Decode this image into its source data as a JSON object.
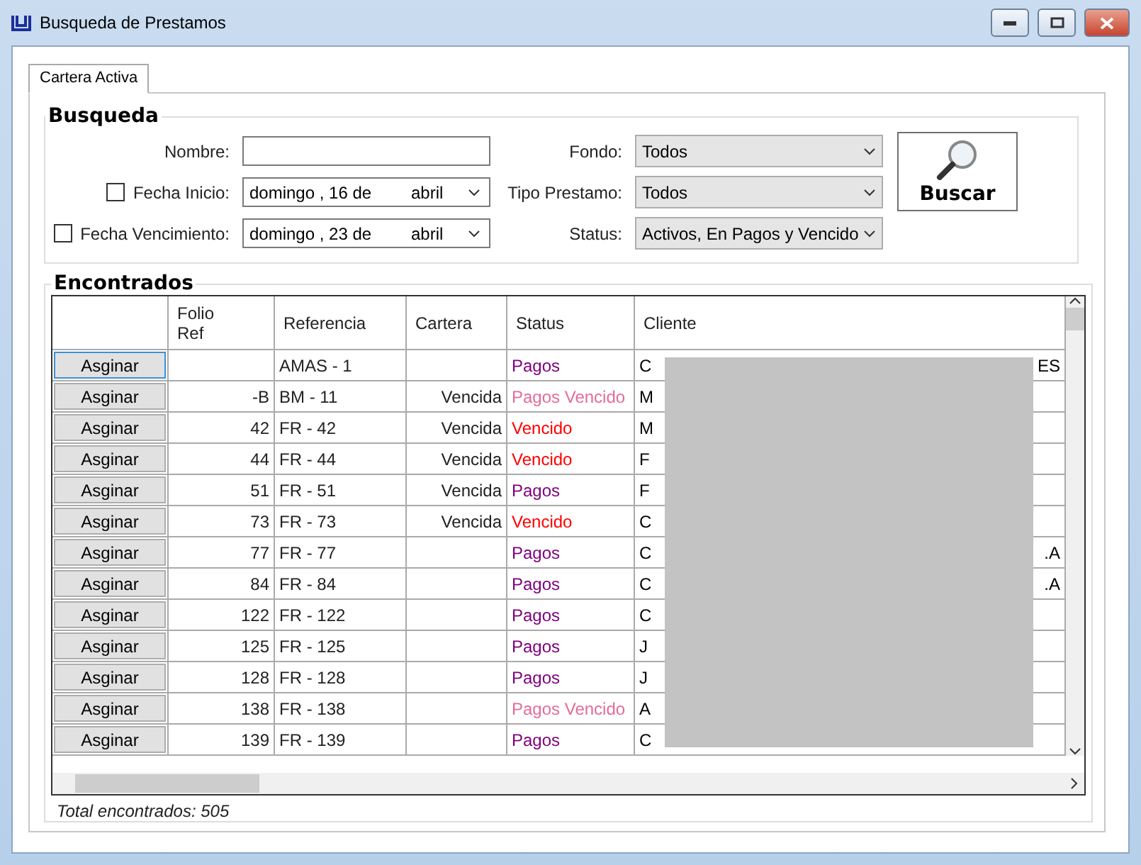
{
  "window": {
    "title": "Busqueda de Prestamos"
  },
  "tabs": [
    {
      "label": "Cartera Activa",
      "selected": true
    }
  ],
  "search": {
    "title": "Busqueda",
    "nombre": {
      "label": "Nombre:"
    },
    "fecha_inicio": {
      "label": "Fecha Inicio:",
      "checked": false,
      "weekday": "domingo , 16 de",
      "month": "abril"
    },
    "fecha_vencimiento": {
      "label": "Fecha Vencimiento:",
      "checked": false,
      "weekday": "domingo , 23 de",
      "month": "abril"
    },
    "fondo": {
      "label": "Fondo:",
      "value": "Todos"
    },
    "tipo": {
      "label": "Tipo Prestamo:",
      "value": "Todos"
    },
    "status": {
      "label": "Status:",
      "value": "Activos, En Pagos y Vencido"
    },
    "button": "Buscar"
  },
  "results": {
    "title": "Encontrados",
    "columns": [
      "Folio\nRef",
      "Referencia",
      "Cartera",
      "Status",
      "Cliente"
    ],
    "rows": [
      {
        "button": "Asginar",
        "focused": true,
        "folio": "",
        "ref": "AMAS - 1",
        "cartera": "",
        "status": "Pagos",
        "color": "#800080",
        "cliente": "C",
        "cliente_end": "ES"
      },
      {
        "button": "Asginar",
        "focused": false,
        "folio": "-B",
        "ref": "BM - 11",
        "cartera": "Vencida",
        "status": "Pagos Vencido",
        "color": "#e36c9a",
        "cliente": "M",
        "cliente_end": ""
      },
      {
        "button": "Asginar",
        "focused": false,
        "folio": "42",
        "ref": "FR - 42",
        "cartera": "Vencida",
        "status": "Vencido",
        "color": "#ff0000",
        "cliente": "M",
        "cliente_end": ""
      },
      {
        "button": "Asginar",
        "focused": false,
        "folio": "44",
        "ref": "FR - 44",
        "cartera": "Vencida",
        "status": "Vencido",
        "color": "#ff0000",
        "cliente": "F",
        "cliente_end": ""
      },
      {
        "button": "Asginar",
        "focused": false,
        "folio": "51",
        "ref": "FR - 51",
        "cartera": "Vencida",
        "status": "Pagos",
        "color": "#800080",
        "cliente": "F",
        "cliente_end": ""
      },
      {
        "button": "Asginar",
        "focused": false,
        "folio": "73",
        "ref": "FR - 73",
        "cartera": "Vencida",
        "status": "Vencido",
        "color": "#ff0000",
        "cliente": "C",
        "cliente_end": ""
      },
      {
        "button": "Asginar",
        "focused": false,
        "folio": "77",
        "ref": "FR - 77",
        "cartera": "",
        "status": "Pagos",
        "color": "#800080",
        "cliente": "C",
        "cliente_end": ".A"
      },
      {
        "button": "Asginar",
        "focused": false,
        "folio": "84",
        "ref": "FR - 84",
        "cartera": "",
        "status": "Pagos",
        "color": "#800080",
        "cliente": "C",
        "cliente_end": ".A"
      },
      {
        "button": "Asginar",
        "focused": false,
        "folio": "122",
        "ref": "FR - 122",
        "cartera": "",
        "status": "Pagos",
        "color": "#800080",
        "cliente": "C",
        "cliente_end": ""
      },
      {
        "button": "Asginar",
        "focused": false,
        "folio": "125",
        "ref": "FR - 125",
        "cartera": "",
        "status": "Pagos",
        "color": "#800080",
        "cliente": "J",
        "cliente_end": ""
      },
      {
        "button": "Asginar",
        "focused": false,
        "folio": "128",
        "ref": "FR - 128",
        "cartera": "",
        "status": "Pagos",
        "color": "#800080",
        "cliente": "J",
        "cliente_end": ""
      },
      {
        "button": "Asginar",
        "focused": false,
        "folio": "138",
        "ref": "FR - 138",
        "cartera": "",
        "status": "Pagos Vencido",
        "color": "#e36c9a",
        "cliente": "A",
        "cliente_end": ""
      },
      {
        "button": "Asginar",
        "focused": false,
        "folio": "139",
        "ref": "FR - 139",
        "cartera": "",
        "status": "Pagos",
        "color": "#800080",
        "cliente": "C",
        "cliente_end": ""
      }
    ],
    "total": "Total encontrados: 505"
  }
}
